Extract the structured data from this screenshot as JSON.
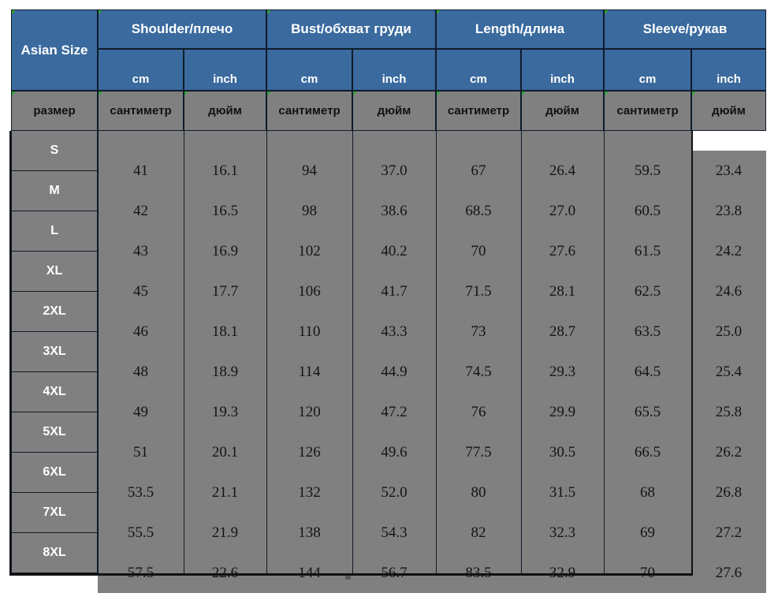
{
  "table": {
    "corner_label": "Asian Size",
    "corner_label_ru": "размер",
    "groups": [
      {
        "title": "Shoulder/плечо",
        "cm": "cm",
        "inch": "inch",
        "cm_ru": "сантиметр",
        "inch_ru": "дюйм"
      },
      {
        "title": "Bust/обхват груди",
        "cm": "cm",
        "inch": "inch",
        "cm_ru": "сантиметр",
        "inch_ru": "дюйм"
      },
      {
        "title": "Length/длина",
        "cm": "cm",
        "inch": "inch",
        "cm_ru": "сантиметр",
        "inch_ru": "дюйм"
      },
      {
        "title": "Sleeve/рукав",
        "cm": "cm",
        "inch": "inch",
        "cm_ru": "сантиметр",
        "inch_ru": "дюйм"
      }
    ],
    "sizes": [
      "S",
      "M",
      "L",
      "XL",
      "2XL",
      "3XL",
      "4XL",
      "5XL",
      "6XL",
      "7XL",
      "8XL"
    ],
    "rows": [
      {
        "size": "S",
        "shoulder_cm": "41",
        "shoulder_in": "16.1",
        "bust_cm": "94",
        "bust_in": "37.0",
        "length_cm": "67",
        "length_in": "26.4",
        "sleeve_cm": "59.5",
        "sleeve_in": "23.4"
      },
      {
        "size": "M",
        "shoulder_cm": "42",
        "shoulder_in": "16.5",
        "bust_cm": "98",
        "bust_in": "38.6",
        "length_cm": "68.5",
        "length_in": "27.0",
        "sleeve_cm": "60.5",
        "sleeve_in": "23.8"
      },
      {
        "size": "L",
        "shoulder_cm": "43",
        "shoulder_in": "16.9",
        "bust_cm": "102",
        "bust_in": "40.2",
        "length_cm": "70",
        "length_in": "27.6",
        "sleeve_cm": "61.5",
        "sleeve_in": "24.2"
      },
      {
        "size": "XL",
        "shoulder_cm": "45",
        "shoulder_in": "17.7",
        "bust_cm": "106",
        "bust_in": "41.7",
        "length_cm": "71.5",
        "length_in": "28.1",
        "sleeve_cm": "62.5",
        "sleeve_in": "24.6"
      },
      {
        "size": "2XL",
        "shoulder_cm": "46",
        "shoulder_in": "18.1",
        "bust_cm": "110",
        "bust_in": "43.3",
        "length_cm": "73",
        "length_in": "28.7",
        "sleeve_cm": "63.5",
        "sleeve_in": "25.0"
      },
      {
        "size": "3XL",
        "shoulder_cm": "48",
        "shoulder_in": "18.9",
        "bust_cm": "114",
        "bust_in": "44.9",
        "length_cm": "74.5",
        "length_in": "29.3",
        "sleeve_cm": "64.5",
        "sleeve_in": "25.4"
      },
      {
        "size": "4XL",
        "shoulder_cm": "49",
        "shoulder_in": "19.3",
        "bust_cm": "120",
        "bust_in": "47.2",
        "length_cm": "76",
        "length_in": "29.9",
        "sleeve_cm": "65.5",
        "sleeve_in": "25.8"
      },
      {
        "size": "5XL",
        "shoulder_cm": "51",
        "shoulder_in": "20.1",
        "bust_cm": "126",
        "bust_in": "49.6",
        "length_cm": "77.5",
        "length_in": "30.5",
        "sleeve_cm": "66.5",
        "sleeve_in": "26.2"
      },
      {
        "size": "6XL",
        "shoulder_cm": "53.5",
        "shoulder_in": "21.1",
        "bust_cm": "132",
        "bust_in": "52.0",
        "length_cm": "80",
        "length_in": "31.5",
        "sleeve_cm": "68",
        "sleeve_in": "26.8"
      },
      {
        "size": "7XL",
        "shoulder_cm": "55.5",
        "shoulder_in": "21.9",
        "bust_cm": "138",
        "bust_in": "54.3",
        "length_cm": "82",
        "length_in": "32.3",
        "sleeve_cm": "69",
        "sleeve_in": "27.2"
      },
      {
        "size": "8XL",
        "shoulder_cm": "57.5",
        "shoulder_in": "22.6",
        "bust_cm": "144",
        "bust_in": "56.7",
        "length_cm": "83.5",
        "length_in": "32.9",
        "sleeve_cm": "70",
        "sleeve_in": "27.6"
      }
    ]
  },
  "colors": {
    "header_blue": "#3a6a9e",
    "body_gray": "#808080",
    "grid_dark": "#0f1b2b",
    "comment_marker_green": "#2ea82e"
  }
}
